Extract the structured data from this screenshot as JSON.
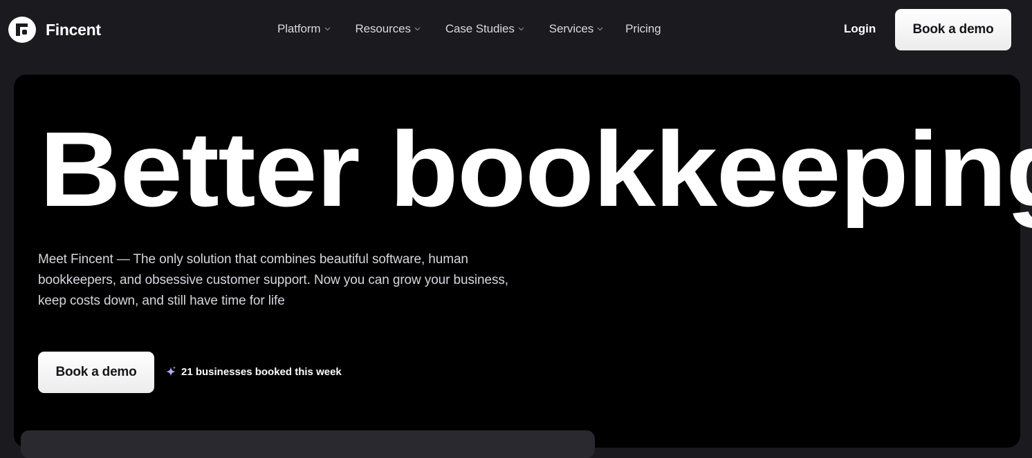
{
  "brand": {
    "name": "Fincent",
    "logo_icon": "fincent-logo-icon"
  },
  "nav": {
    "items": [
      {
        "label": "Platform",
        "has_dropdown": true
      },
      {
        "label": "Resources",
        "has_dropdown": true
      },
      {
        "label": "Case Studies",
        "has_dropdown": true
      },
      {
        "label": "Services",
        "has_dropdown": true
      },
      {
        "label": "Pricing",
        "has_dropdown": false
      }
    ],
    "login_label": "Login",
    "cta_label": "Book a demo"
  },
  "hero": {
    "headline": "Better bookkeeping",
    "subcopy": "Meet Fincent — The only solution that combines beautiful software, human bookkeepers, and obsessive customer support. Now you can grow your business, keep costs down, and still have time for life",
    "cta_label": "Book a demo",
    "booked_text": "21 businesses booked this week",
    "booked_icon": "sparkle-icon"
  },
  "colors": {
    "page_bg": "#1b1a1f",
    "hero_bg": "#000000",
    "text": "#ffffff",
    "muted_text": "#d7d6dc",
    "button_bg": "#ffffff",
    "button_text": "#16151a",
    "sparkle": "#b9a7ff"
  }
}
